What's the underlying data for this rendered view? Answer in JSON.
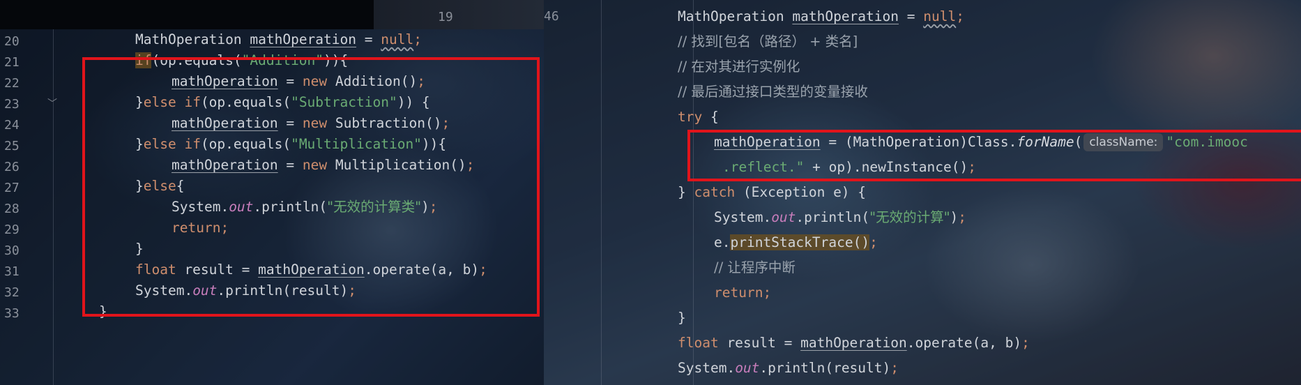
{
  "left": {
    "lines": [
      {
        "n": "20"
      },
      {
        "n": "21"
      },
      {
        "n": "22"
      },
      {
        "n": "23"
      },
      {
        "n": "24"
      },
      {
        "n": "25"
      },
      {
        "n": "26"
      },
      {
        "n": "27"
      },
      {
        "n": "28"
      },
      {
        "n": "29"
      },
      {
        "n": "30"
      },
      {
        "n": "31"
      },
      {
        "n": "32"
      },
      {
        "n": "33"
      }
    ],
    "strip_line_number": "19",
    "tokens": {
      "l20_a": "MathOperation ",
      "l20_b": "mathOperation",
      "l20_c": " = ",
      "l20_d": "null",
      "l20_e": ";",
      "l21_a": "if",
      "l21_b": "(op.equals(",
      "l21_c": "\"Addition\"",
      "l21_d": ")){",
      "l22_a": "mathOperation",
      "l22_b": " = ",
      "l22_c": "new",
      "l22_d": " Addition()",
      "l22_e": ";",
      "l23_a": "}",
      "l23_b": "else if",
      "l23_c": "(op.equals(",
      "l23_d": "\"Subtraction\"",
      "l23_e": ")) {",
      "l24_a": "mathOperation",
      "l24_b": " = ",
      "l24_c": "new",
      "l24_d": " Subtraction()",
      "l24_e": ";",
      "l25_a": "}",
      "l25_b": "else if",
      "l25_c": "(op.equals(",
      "l25_d": "\"Multiplication\"",
      "l25_e": ")){",
      "l26_a": "mathOperation",
      "l26_b": " = ",
      "l26_c": "new",
      "l26_d": " Multiplication()",
      "l26_e": ";",
      "l27_a": "}",
      "l27_b": "else",
      "l27_c": "{",
      "l28_a": "System.",
      "l28_b": "out",
      "l28_c": ".println(",
      "l28_d": "\"无效的计算类\"",
      "l28_e": ")",
      "l28_f": ";",
      "l29_a": "return",
      "l29_b": ";",
      "l30_a": "}",
      "l31_a": "float",
      "l31_b": " result = ",
      "l31_c": "mathOperation",
      "l31_d": ".operate(a, b)",
      "l31_e": ";",
      "l32_a": "System.",
      "l32_b": "out",
      "l32_c": ".println(result)",
      "l32_d": ";",
      "l33_a": "}"
    }
  },
  "right": {
    "line_number": "46",
    "tokens": {
      "r1_a": "MathOperation ",
      "r1_b": "mathOperation",
      "r1_c": " = ",
      "r1_d": "null",
      "r1_e": ";",
      "r2": "// 找到[包名（路径） + 类名]",
      "r3": "// 在对其进行实例化",
      "r4": "// 最后通过接口类型的变量接收",
      "r5_a": "try",
      "r5_b": " {",
      "r6_a": "mathOperation",
      "r6_b": " = (MathOperation)Class.",
      "r6_c": "forName",
      "r6_d": "(",
      "r6_hint": "className:",
      "r6_e": "\"com.imooc",
      "r7_a": ".reflect.\"",
      "r7_b": " + op).newInstance()",
      "r7_c": ";",
      "r8_a": "} ",
      "r8_b": "catch",
      "r8_c": " (Exception e) {",
      "r9_a": "System.",
      "r9_b": "out",
      "r9_c": ".println(",
      "r9_d": "\"无效的计算\"",
      "r9_e": ")",
      "r9_f": ";",
      "r10_a": "e.",
      "r10_b": "printStackTrace()",
      "r10_c": ";",
      "r11": "// 让程序中断",
      "r12_a": "return",
      "r12_b": ";",
      "r13": "}",
      "r14_a": "float",
      "r14_b": " result = ",
      "r14_c": "mathOperation",
      "r14_d": ".operate(a, b)",
      "r14_e": ";",
      "r15_a": "System.",
      "r15_b": "out",
      "r15_c": ".println(result)",
      "r15_d": ";"
    }
  },
  "colors": {
    "keyword": "#cf8e6d",
    "string": "#6aab73",
    "static_field": "#c77dbb",
    "highlight_box": "#e1141b"
  }
}
